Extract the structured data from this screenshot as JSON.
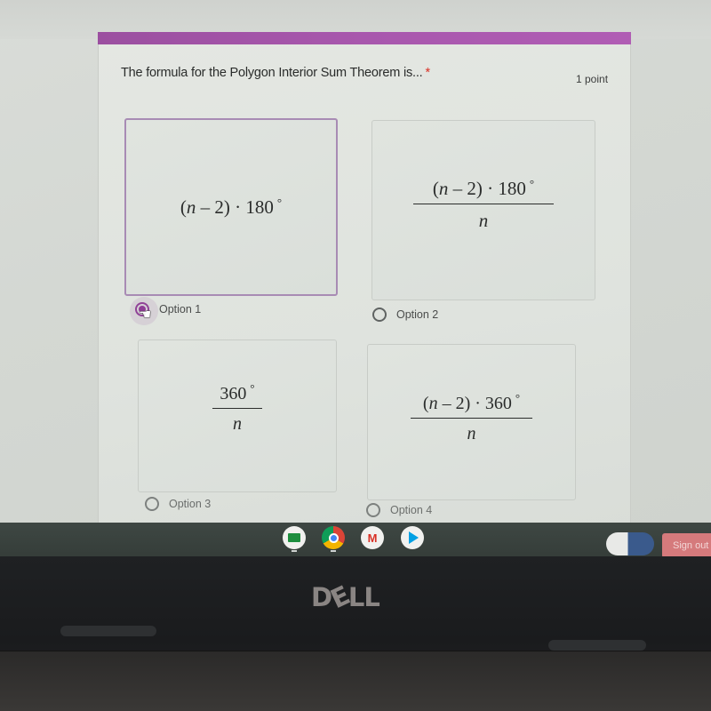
{
  "form": {
    "accent_color": "#a857ad",
    "question": {
      "title": "The formula for the Polygon Interior Sum Theorem is...",
      "required_marker": "*",
      "points": "1 point"
    },
    "options": [
      {
        "label": "Option 1",
        "selected": true,
        "formula": {
          "type": "inline",
          "open": "(",
          "var": "n",
          "rest": " – 2) · 180",
          "degree": "°"
        }
      },
      {
        "label": "Option 2",
        "selected": false,
        "formula": {
          "type": "fraction",
          "open": "(",
          "var": "n",
          "rest": " – 2) · 180",
          "degree": "°",
          "denominator": "n"
        }
      },
      {
        "label": "Option 3",
        "selected": false,
        "formula": {
          "type": "fraction",
          "numerator": "360",
          "degree": "°",
          "denominator": "n"
        }
      },
      {
        "label": "Option 4",
        "selected": false,
        "formula": {
          "type": "fraction",
          "open": "(",
          "var": "n",
          "rest": " – 2) · 360",
          "degree": "°",
          "denominator": "n"
        }
      }
    ]
  },
  "shelf": {
    "apps": [
      {
        "name": "Google Classroom",
        "icon": "classroom-icon"
      },
      {
        "name": "Chrome",
        "icon": "chrome-icon"
      },
      {
        "name": "Gmail",
        "icon": "gmail-icon",
        "glyph": "M"
      },
      {
        "name": "Play Store",
        "icon": "play-store-icon"
      }
    ],
    "sign_out_label": "Sign out"
  },
  "device": {
    "brand": "DELL"
  }
}
